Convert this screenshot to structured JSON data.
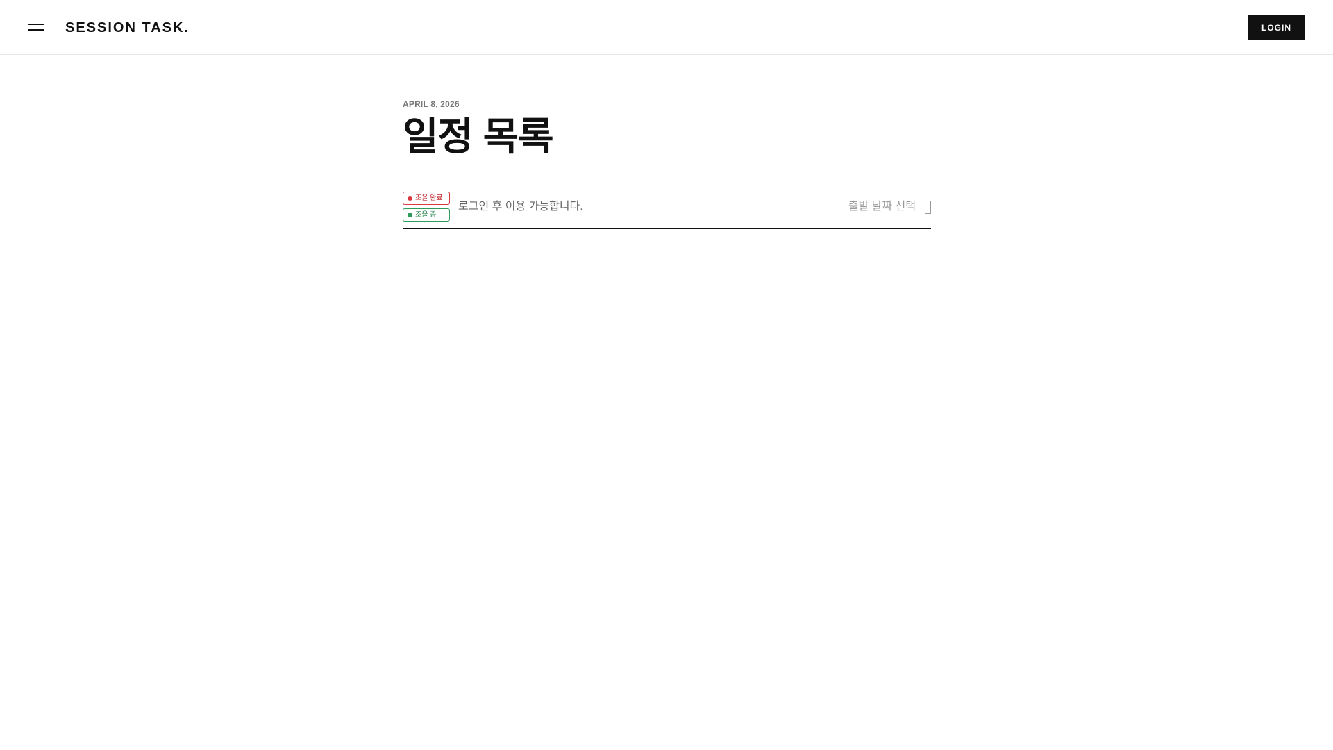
{
  "header": {
    "brand": "SESSION TASK.",
    "login_label": "LOGIN"
  },
  "main": {
    "date": "APRIL 8, 2026",
    "title": "일정 목록",
    "legend": [
      {
        "label": "조율 완료",
        "color": "#d9383e"
      },
      {
        "label": "조율 중",
        "color": "#2e9a5b"
      }
    ],
    "login_required_message": "로그인 후 이용 가능합니다.",
    "date_picker": {
      "label": "출발 날짜 선택",
      "icon": "calendar-icon"
    }
  }
}
